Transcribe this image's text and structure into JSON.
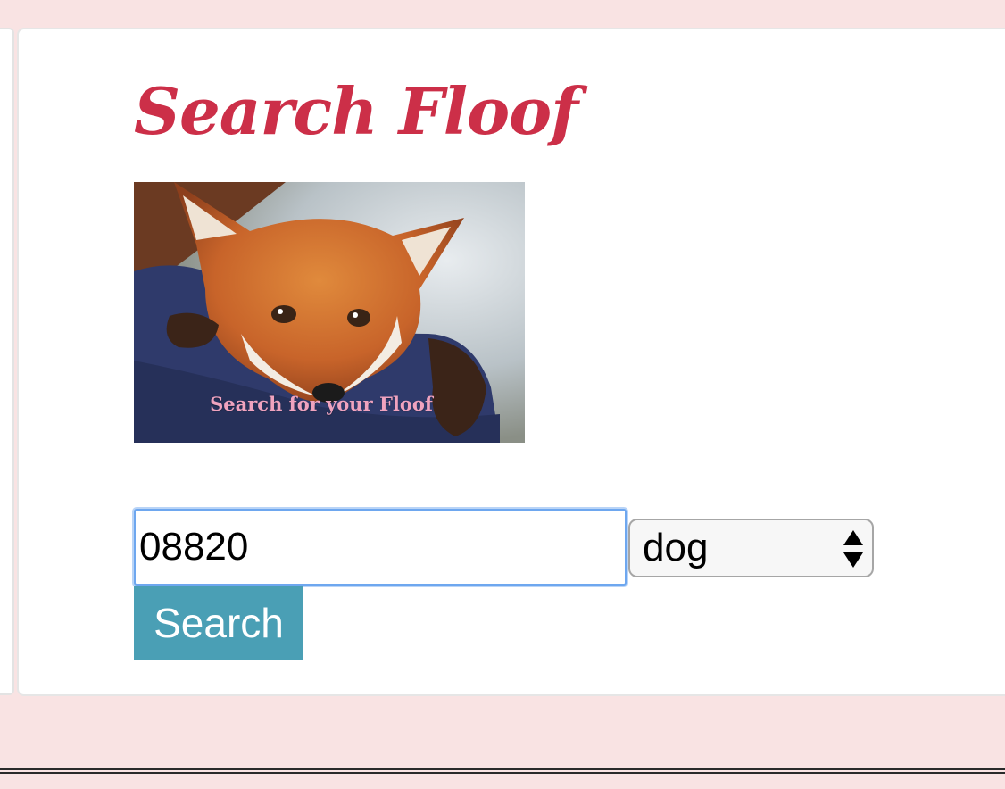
{
  "page": {
    "title": "Search Floof"
  },
  "hero": {
    "caption": "Search for your Floof"
  },
  "search": {
    "zip_value": "08820",
    "animal_selected": "dog",
    "button_label": "Search"
  },
  "colors": {
    "page_background": "#f9e3e3",
    "title": "#cc2f48",
    "button": "#4a9fb5",
    "caption": "#f0a3bf"
  },
  "icons": {
    "select_arrows": "up-down-arrows-icon"
  }
}
